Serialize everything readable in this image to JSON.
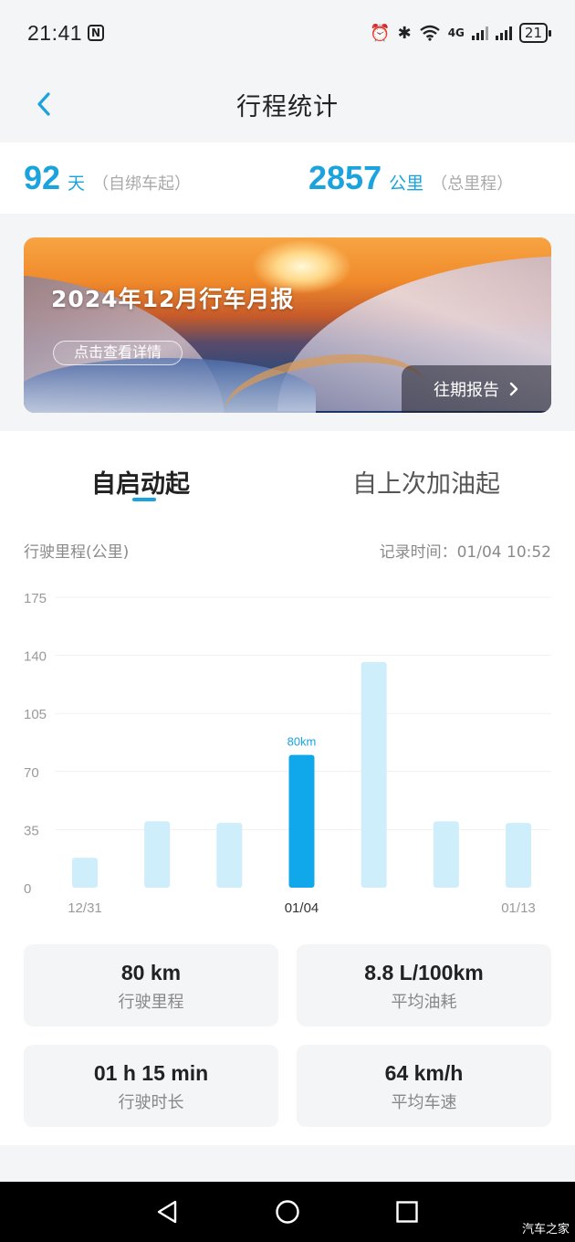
{
  "status": {
    "time": "21:41",
    "nfc": "N",
    "network": "4G",
    "battery": "21"
  },
  "nav": {
    "title": "行程统计"
  },
  "summary": {
    "days_value": "92",
    "days_unit": "天",
    "days_note": "（自绑车起）",
    "km_value": "2857",
    "km_unit": "公里",
    "km_note": "（总里程）"
  },
  "banner": {
    "title": "2024年12月行车月报",
    "detail_button": "点击查看详情",
    "past_reports": "往期报告"
  },
  "tabs": [
    {
      "label": "自启动起",
      "active": true
    },
    {
      "label": "自上次加油起",
      "active": false
    }
  ],
  "chart_header": {
    "left": "行驶里程(公里)",
    "right": "记录时间：01/04 10:52"
  },
  "chart_data": {
    "type": "bar",
    "ylim": [
      0,
      175
    ],
    "yticks": [
      "0",
      "35",
      "70",
      "105",
      "140",
      "175"
    ],
    "values": [
      18,
      40,
      39,
      80,
      136,
      40,
      39
    ],
    "highlight_index": 3,
    "highlight_label": "80km",
    "xlabels": [
      {
        "index": 0,
        "text": "12/31"
      },
      {
        "index": 3,
        "text": "01/04"
      },
      {
        "index": 6,
        "text": "01/13"
      }
    ],
    "colors": {
      "normal": "#cdeefa",
      "highlight": "#10a8ea"
    }
  },
  "stats": [
    {
      "value": "80 km",
      "label": "行驶里程"
    },
    {
      "value": "8.8 L/100km",
      "label": "平均油耗"
    },
    {
      "value": "01 h 15 min",
      "label": "行驶时长"
    },
    {
      "value": "64 km/h",
      "label": "平均车速"
    }
  ],
  "watermark": "汽车之家"
}
